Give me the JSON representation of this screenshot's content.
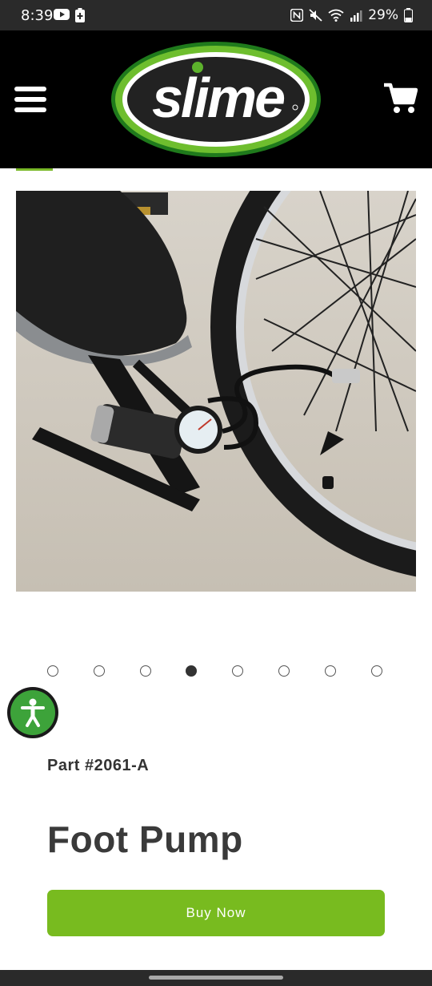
{
  "status_bar": {
    "time": "8:39",
    "battery": "29%",
    "icons": [
      "youtube-icon",
      "battery-saver-icon",
      "nfc-icon",
      "mute-icon",
      "wifi-icon",
      "signal-icon",
      "battery-icon"
    ]
  },
  "header": {
    "logo_text": "slime",
    "menu_icon": "hamburger-menu-icon",
    "cart_icon": "shopping-cart-icon",
    "colors": {
      "background": "#000000",
      "logo_green": "#3a9a2a"
    }
  },
  "carousel": {
    "image_description_icon": "foot-pump-photo",
    "total_slides": 8,
    "active_index": 3
  },
  "product": {
    "part_number": "Part #2061-A",
    "title": "Foot Pump",
    "buy_label": "Buy Now"
  },
  "accessibility": {
    "icon": "accessibility-person-icon"
  },
  "colors": {
    "buy_button": "#78bb1f",
    "title": "#3a3a3a"
  }
}
